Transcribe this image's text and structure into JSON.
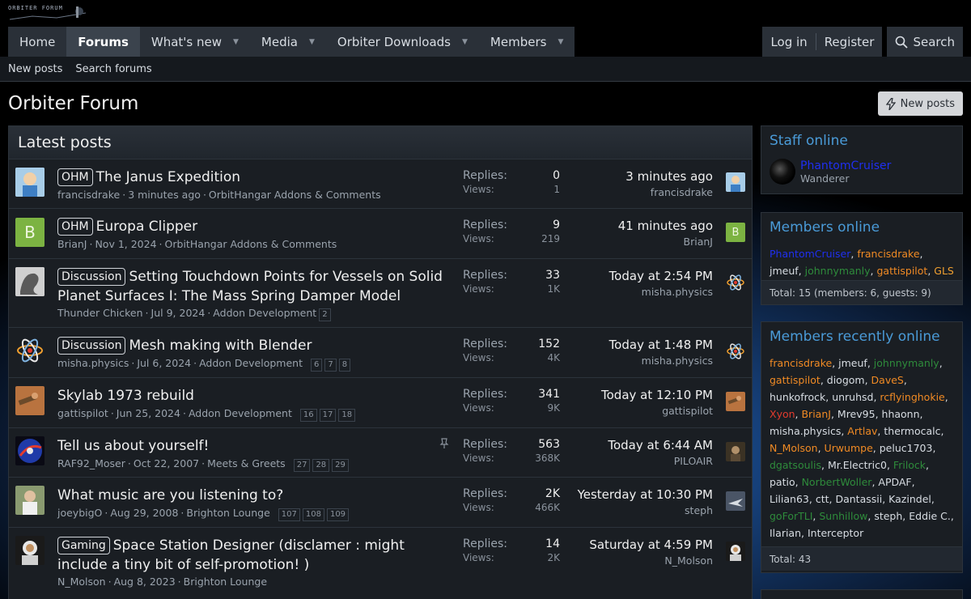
{
  "logo_text": "ORBITER FORUM",
  "nav": {
    "tabs": [
      {
        "label": "Home"
      },
      {
        "label": "Forums"
      },
      {
        "label": "What's new"
      },
      {
        "label": "Media"
      },
      {
        "label": "Orbiter Downloads"
      },
      {
        "label": "Members"
      }
    ],
    "login": "Log in",
    "register": "Register",
    "search": "Search"
  },
  "subnav": {
    "new_posts": "New posts",
    "search_forums": "Search forums"
  },
  "page_title": "Orbiter Forum",
  "new_posts_button": "New posts",
  "latest": {
    "title": "Latest posts",
    "replies_label": "Replies:",
    "views_label": "Views:",
    "threads": [
      {
        "prefix": "OHM",
        "title": "The Janus Expedition",
        "author": "francisdrake",
        "date": "3 minutes ago",
        "forum": "OrbitHangar Addons & Comments",
        "pages": [],
        "replies": "0",
        "views": "1",
        "last_time": "3 minutes ago",
        "last_user": "francisdrake"
      },
      {
        "prefix": "OHM",
        "title": "Europa Clipper",
        "author": "BrianJ",
        "date": "Nov 1, 2024",
        "forum": "OrbitHangar Addons & Comments",
        "pages": [],
        "replies": "9",
        "views": "219",
        "last_time": "41 minutes ago",
        "last_user": "BrianJ"
      },
      {
        "prefix": "Discussion",
        "title": "Setting Touchdown Points for Vessels on Solid Planet Surfaces I: The Mass Spring Damper Model",
        "author": "Thunder Chicken",
        "date": "Jul 9, 2024",
        "forum": "Addon Development",
        "pages": [
          "2"
        ],
        "replies": "33",
        "views": "1K",
        "last_time": "Today at 2:54 PM",
        "last_user": "misha.physics"
      },
      {
        "prefix": "Discussion",
        "title": "Mesh making with Blender",
        "author": "misha.physics",
        "date": "Jul 6, 2024",
        "forum": "Addon Development",
        "pages": [
          "6",
          "7",
          "8"
        ],
        "replies": "152",
        "views": "4K",
        "last_time": "Today at 1:48 PM",
        "last_user": "misha.physics"
      },
      {
        "prefix": "",
        "title": "Skylab 1973 rebuild",
        "author": "gattispilot",
        "date": "Jun 25, 2024",
        "forum": "Addon Development",
        "pages": [
          "16",
          "17",
          "18"
        ],
        "replies": "341",
        "views": "9K",
        "last_time": "Today at 12:10 PM",
        "last_user": "gattispilot"
      },
      {
        "prefix": "",
        "title": "Tell us about yourself!",
        "author": "RAF92_Moser",
        "date": "Oct 22, 2007",
        "forum": "Meets & Greets",
        "pages": [
          "27",
          "28",
          "29"
        ],
        "replies": "563",
        "views": "368K",
        "last_time": "Today at 6:44 AM",
        "last_user": "PILOAIR"
      },
      {
        "prefix": "",
        "title": "What music are you listening to?",
        "author": "joeybigO",
        "date": "Aug 29, 2008",
        "forum": "Brighton Lounge",
        "pages": [
          "107",
          "108",
          "109"
        ],
        "replies": "2K",
        "views": "466K",
        "last_time": "Yesterday at 10:30 PM",
        "last_user": "steph"
      },
      {
        "prefix": "Gaming",
        "title": "Space Station Designer (disclamer : might include a tiny bit of self-promotion! )",
        "author": "N_Molson",
        "date": "Aug 8, 2023",
        "forum": "Brighton Lounge",
        "pages": [],
        "replies": "14",
        "views": "2K",
        "last_time": "Saturday at 4:59 PM",
        "last_user": "N_Molson"
      }
    ]
  },
  "staff_online": {
    "title": "Staff online",
    "name": "PhantomCruiser",
    "role": "Wanderer"
  },
  "members_online": {
    "title": "Members online",
    "members": [
      {
        "name": "PhantomCruiser",
        "color": "#1f2ff0"
      },
      {
        "name": "francisdrake",
        "color": "#f08a24"
      },
      {
        "name": "jmeuf",
        "color": "#d8dde3"
      },
      {
        "name": "johnnymanly",
        "color": "#2e8b3b"
      },
      {
        "name": "gattispilot",
        "color": "#f08a24"
      },
      {
        "name": "GLS",
        "color": "#f0a030"
      }
    ],
    "total": "Total: 15 (members: 6, guests: 9)"
  },
  "recently_online": {
    "title": "Members recently online",
    "members": [
      {
        "name": "francisdrake",
        "color": "#f08a24"
      },
      {
        "name": "jmeuf",
        "color": "#d8dde3"
      },
      {
        "name": "johnnymanly",
        "color": "#2e8b3b"
      },
      {
        "name": "gattispilot",
        "color": "#f08a24"
      },
      {
        "name": "diogom",
        "color": "#d8dde3"
      },
      {
        "name": "DaveS",
        "color": "#f08a24"
      },
      {
        "name": "hunkofrock",
        "color": "#d8dde3"
      },
      {
        "name": "unruhsd",
        "color": "#d8dde3"
      },
      {
        "name": "rcflyinghokie",
        "color": "#f08a24"
      },
      {
        "name": "Xyon",
        "color": "#e33b2e"
      },
      {
        "name": "BrianJ",
        "color": "#f08a24"
      },
      {
        "name": "Mrev95",
        "color": "#d8dde3"
      },
      {
        "name": "hhaonn",
        "color": "#d8dde3"
      },
      {
        "name": "misha.physics",
        "color": "#d8dde3"
      },
      {
        "name": "Artlav",
        "color": "#f08a24"
      },
      {
        "name": "thermocalc",
        "color": "#d8dde3"
      },
      {
        "name": "N_Molson",
        "color": "#f08a24"
      },
      {
        "name": "Urwumpe",
        "color": "#f08a24"
      },
      {
        "name": "peluc1703",
        "color": "#d8dde3"
      },
      {
        "name": "dgatsoulis",
        "color": "#2e8b3b"
      },
      {
        "name": "Mr.Electric0",
        "color": "#d8dde3"
      },
      {
        "name": "Frilock",
        "color": "#2e8b3b"
      },
      {
        "name": "patio",
        "color": "#d8dde3"
      },
      {
        "name": "NorbertWoller",
        "color": "#2e8b3b"
      },
      {
        "name": "APDAF",
        "color": "#d8dde3"
      },
      {
        "name": "Lilian63",
        "color": "#d8dde3"
      },
      {
        "name": "ctt",
        "color": "#d8dde3"
      },
      {
        "name": "Dantassii",
        "color": "#d8dde3"
      },
      {
        "name": "Kazindel",
        "color": "#d8dde3"
      },
      {
        "name": "goForTLI",
        "color": "#2e8b3b"
      },
      {
        "name": "Sunhillow",
        "color": "#2e8b3b"
      },
      {
        "name": "steph",
        "color": "#d8dde3"
      },
      {
        "name": "Eddie C.",
        "color": "#d8dde3"
      },
      {
        "name": "Ilarian",
        "color": "#d8dde3"
      },
      {
        "name": "Interceptor",
        "color": "#d8dde3"
      }
    ],
    "total": "Total: 43"
  }
}
